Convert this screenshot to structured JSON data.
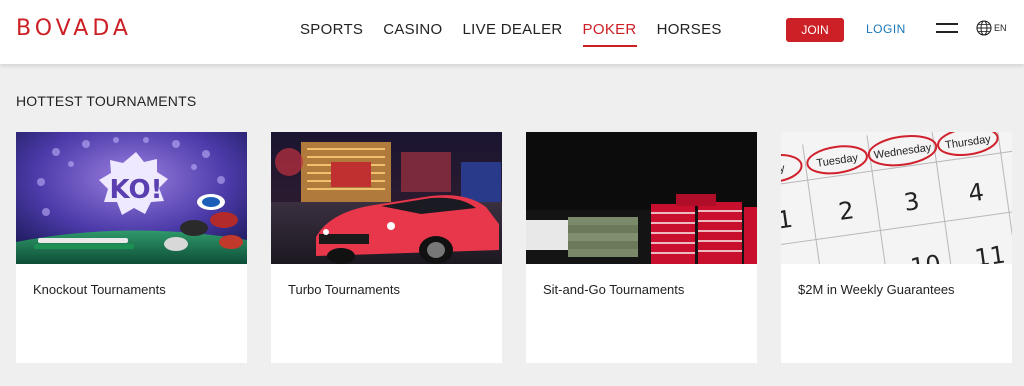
{
  "brand": {
    "logo_text": "BOVADA",
    "accent_color": "#cc1f26"
  },
  "nav": {
    "items": [
      {
        "label": "SPORTS",
        "active": false
      },
      {
        "label": "CASINO",
        "active": false
      },
      {
        "label": "LIVE DEALER",
        "active": false
      },
      {
        "label": "POKER",
        "active": true
      },
      {
        "label": "HORSES",
        "active": false
      }
    ]
  },
  "header_actions": {
    "join_label": "JOIN",
    "login_label": "LOGIN",
    "menu_icon": "hamburger-icon",
    "language_icon": "globe-icon",
    "language_code": "EN"
  },
  "section": {
    "title": "HOTTEST TOURNAMENTS",
    "cards": [
      {
        "label": "Knockout Tournaments",
        "image_text": "KO!"
      },
      {
        "label": "Turbo Tournaments"
      },
      {
        "label": "Sit-and-Go Tournaments"
      },
      {
        "label": "$2M in Weekly Guarantees",
        "image_days": [
          "day",
          "Tuesday",
          "Wednesday",
          "Thursday"
        ],
        "image_numbers": [
          "1",
          "2",
          "3",
          "4",
          "10",
          "11"
        ]
      }
    ]
  }
}
